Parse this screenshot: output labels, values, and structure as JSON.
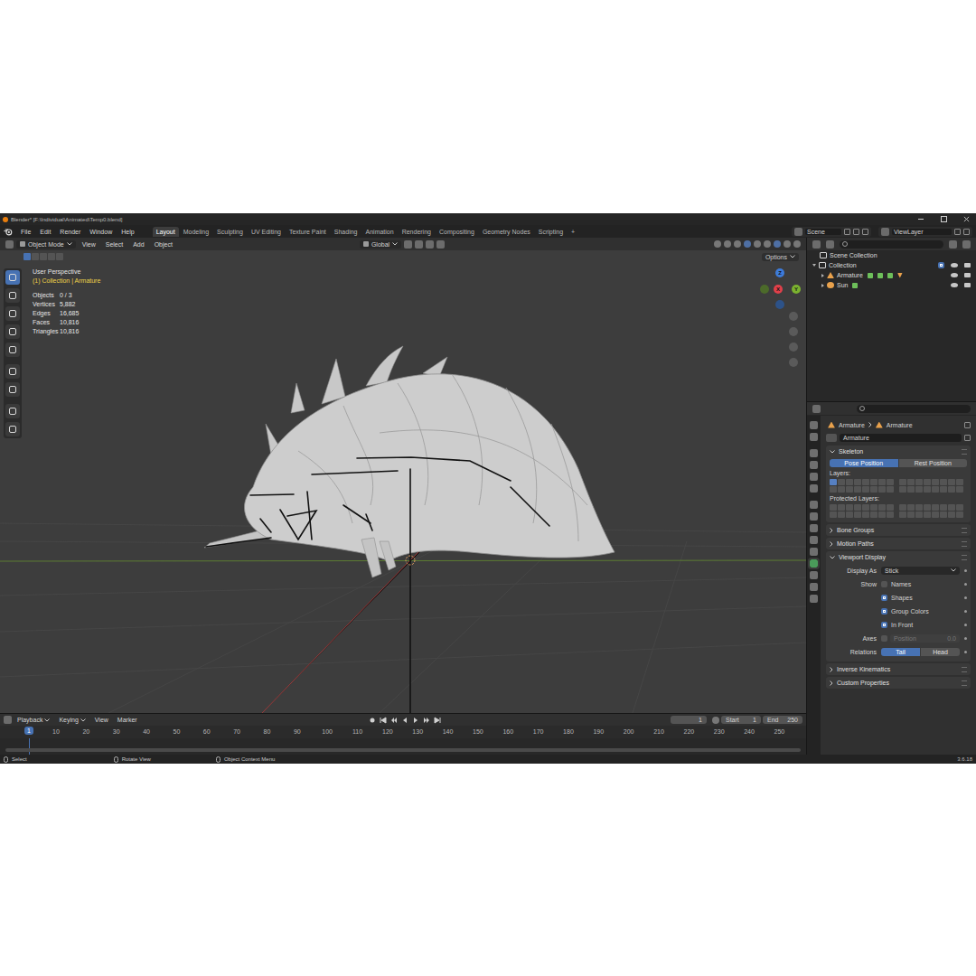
{
  "window": {
    "title": "Blender* [F:\\Individual\\Animated\\Temp0.blend]"
  },
  "menu": [
    "File",
    "Edit",
    "Render",
    "Window",
    "Help"
  ],
  "workspaces": [
    {
      "label": "Layout",
      "selected": true
    },
    {
      "label": "Modeling",
      "selected": false
    },
    {
      "label": "Sculpting",
      "selected": false
    },
    {
      "label": "UV Editing",
      "selected": false
    },
    {
      "label": "Texture Paint",
      "selected": false
    },
    {
      "label": "Shading",
      "selected": false
    },
    {
      "label": "Animation",
      "selected": false
    },
    {
      "label": "Rendering",
      "selected": false
    },
    {
      "label": "Compositing",
      "selected": false
    },
    {
      "label": "Geometry Nodes",
      "selected": false
    },
    {
      "label": "Scripting",
      "selected": false
    }
  ],
  "add_workspace": "+",
  "scene": "Scene",
  "view_layer": "ViewLayer",
  "viewport": {
    "mode": "Object Mode",
    "menus": [
      "View",
      "Select",
      "Add",
      "Object"
    ],
    "orientation": "Global",
    "options": "Options",
    "perspective": "User Perspective",
    "context": "(1) Collection | Armature",
    "stats": [
      {
        "label": "Objects",
        "value": "0 / 3"
      },
      {
        "label": "Vertices",
        "value": "5,882"
      },
      {
        "label": "Edges",
        "value": "16,685"
      },
      {
        "label": "Faces",
        "value": "10,816"
      },
      {
        "label": "Triangles",
        "value": "10,816"
      }
    ],
    "gizmo": [
      {
        "label": "Z",
        "color": "#3d7bd9"
      },
      {
        "label": "X",
        "color": "#e0404a"
      },
      {
        "label": "Y",
        "color": "#7bb22f"
      }
    ]
  },
  "outliner": {
    "root": "Scene Collection",
    "collections": [
      {
        "label": "Collection",
        "expanded": true,
        "included": true,
        "objects": [
          {
            "label": "Armature",
            "expanded": false,
            "kind": "armature"
          },
          {
            "label": "Sun",
            "expanded": false,
            "kind": "light"
          }
        ]
      }
    ]
  },
  "properties": {
    "breadcrumb": [
      "Armature",
      "Armature"
    ],
    "name": "Armature",
    "sections": [
      {
        "title": "Skeleton",
        "expanded": true,
        "kind": "skeleton"
      },
      {
        "title": "Bone Groups",
        "expanded": false,
        "kind": "plain"
      },
      {
        "title": "Motion Paths",
        "expanded": false,
        "kind": "plain"
      },
      {
        "title": "Viewport Display",
        "expanded": true,
        "kind": "display"
      },
      {
        "title": "Inverse Kinematics",
        "expanded": false,
        "kind": "plain"
      },
      {
        "title": "Custom Properties",
        "expanded": false,
        "kind": "plain"
      }
    ],
    "skeleton": {
      "positions": [
        {
          "label": "Pose Position",
          "selected": true
        },
        {
          "label": "Rest Position",
          "selected": false
        }
      ],
      "layers_label": "Layers:",
      "layers": [
        true,
        false,
        false,
        false,
        false,
        false,
        false,
        false,
        false,
        false,
        false,
        false,
        false,
        false,
        false,
        false,
        false,
        false,
        false,
        false,
        false,
        false,
        false,
        false,
        false,
        false,
        false,
        false,
        false,
        false,
        false,
        false
      ],
      "protected_label": "Protected Layers:",
      "protected": [
        false,
        false,
        false,
        false,
        false,
        false,
        false,
        false,
        false,
        false,
        false,
        false,
        false,
        false,
        false,
        false,
        false,
        false,
        false,
        false,
        false,
        false,
        false,
        false,
        false,
        false,
        false,
        false,
        false,
        false,
        false,
        false
      ]
    },
    "display": {
      "display_as_label": "Display As",
      "display_as": "Stick",
      "show_label": "Show",
      "show": [
        {
          "label": "Names",
          "checked": false
        },
        {
          "label": "Shapes",
          "checked": true
        },
        {
          "label": "Group Colors",
          "checked": true
        },
        {
          "label": "In Front",
          "checked": true
        }
      ],
      "axes_label": "Axes",
      "axes_checked": false,
      "axes_position_label": "Position",
      "axes_position": "0.0",
      "axes_position_disabled": true,
      "relations_label": "Relations",
      "relations": [
        {
          "label": "Tail",
          "selected": true
        },
        {
          "label": "Head",
          "selected": false
        }
      ]
    }
  },
  "timeline": {
    "menus": [
      "Playback",
      "Keying",
      "View",
      "Marker"
    ],
    "current_frame": "1",
    "start_label": "Start",
    "start": "1",
    "end_label": "End",
    "end": "250",
    "ticks": [
      "10",
      "20",
      "30",
      "40",
      "50",
      "60",
      "70",
      "80",
      "90",
      "100",
      "110",
      "120",
      "130",
      "140",
      "150",
      "160",
      "170",
      "180",
      "190",
      "200",
      "210",
      "220",
      "230",
      "240",
      "250"
    ]
  },
  "status_bar": {
    "hints": [
      "Select",
      "Rotate View",
      "Object Context Menu"
    ],
    "version": "3.6.18"
  }
}
